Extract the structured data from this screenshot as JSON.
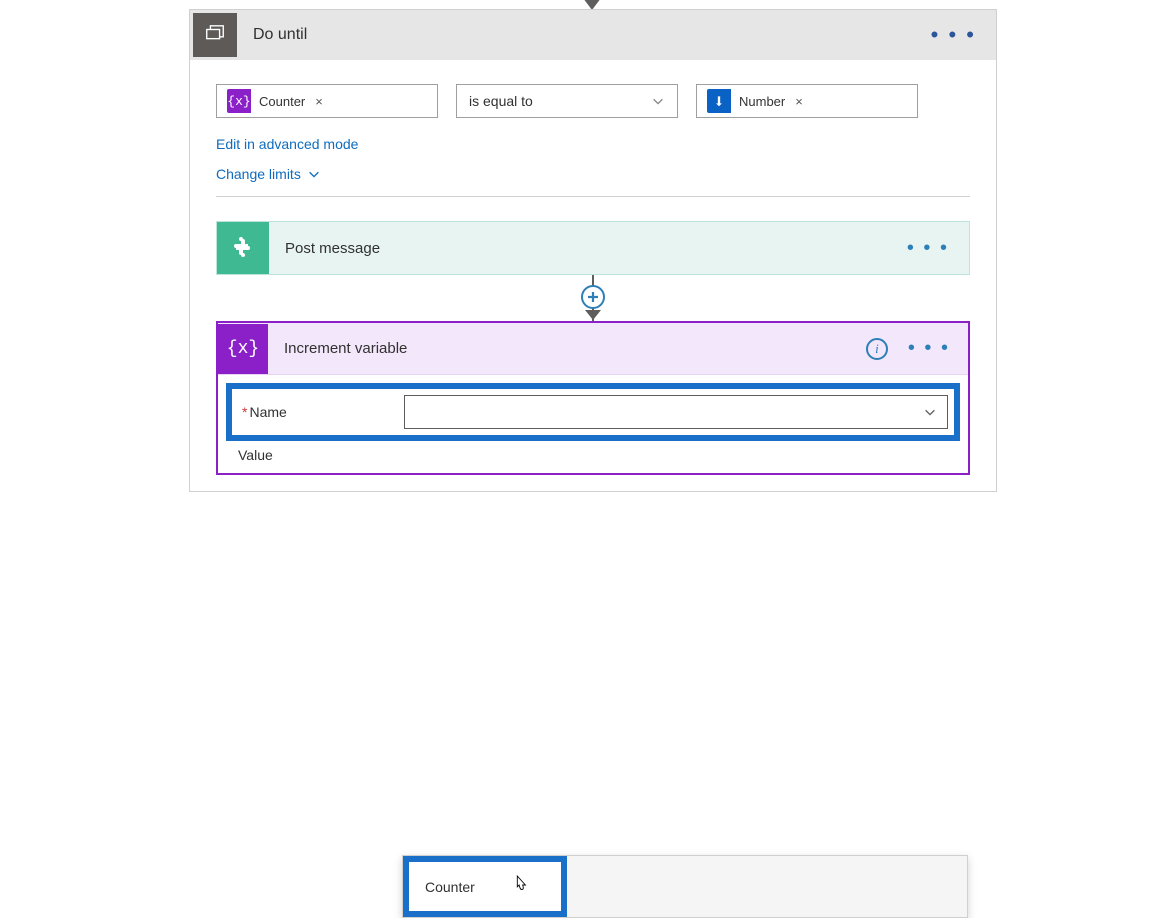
{
  "do_until": {
    "title": "Do until",
    "condition": {
      "left_token": {
        "icon_text": "{x}",
        "label": "Counter"
      },
      "operator": "is equal to",
      "right_token": {
        "label": "Number"
      }
    },
    "edit_advanced": "Edit in advanced mode",
    "change_limits": "Change limits"
  },
  "post_message": {
    "title": "Post message"
  },
  "increment": {
    "title": "Increment variable",
    "icon_text": "{x}",
    "fields": {
      "name_label": "Name",
      "required_mark": "*",
      "value_label": "Value",
      "name_value": ""
    }
  },
  "dropdown": {
    "items": [
      "Counter"
    ]
  },
  "glyphs": {
    "more": "• • •",
    "remove": "×",
    "info": "i"
  }
}
